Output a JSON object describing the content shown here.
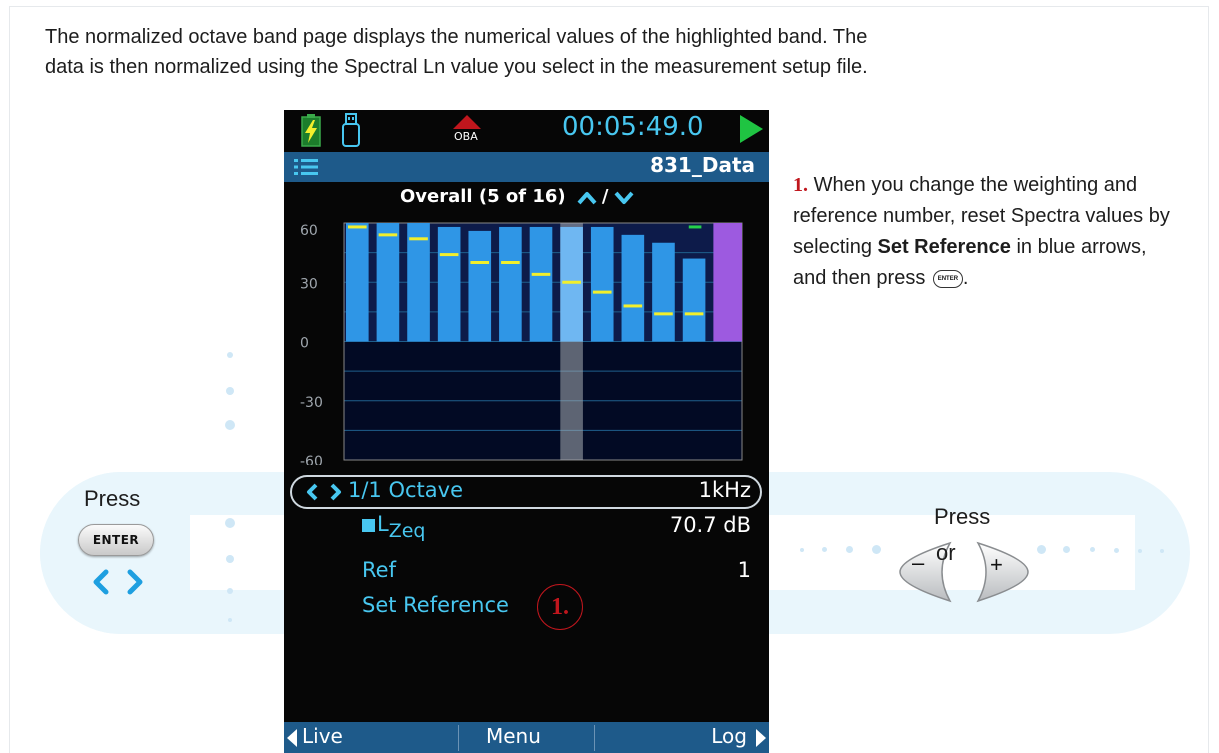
{
  "intro": {
    "line1": "The normalized octave band page displays the numerical values of the highlighted band. The",
    "line2": "data is then normalized using the Spectral Ln value you select in the measurement setup file."
  },
  "left_panel": {
    "press_label": "Press",
    "enter_label": "ENTER"
  },
  "right_panel": {
    "press_label": "Press",
    "or_label": "or",
    "minus_label": "–",
    "plus_label": "+"
  },
  "device": {
    "status": {
      "mode_label": "OBA",
      "clock": "00:05:49.0"
    },
    "title": "831_Data",
    "overall_label": "Overall (5 of 16)",
    "overall_sep": "/",
    "chart": {
      "y_ticks": [
        "60",
        "30",
        "0",
        "-30",
        "-60"
      ],
      "ylim": [
        -60,
        60
      ],
      "bars": [
        60,
        60,
        60,
        58,
        56,
        58,
        58,
        58,
        58,
        54,
        50,
        42
      ],
      "overall_bar": 60,
      "yellow_marks": [
        58,
        54,
        52,
        44,
        40,
        40,
        34,
        30,
        25,
        18,
        14,
        14
      ],
      "green_mark": 58,
      "highlight_index": 7
    },
    "rows": {
      "octave_label": "1/1 Octave",
      "octave_value": "1kHz",
      "lzeq_label": "L",
      "lzeq_sub": "Zeq",
      "lzeq_value": "70.7 dB",
      "ref_label": "Ref",
      "ref_value": "1",
      "set_reference": "Set Reference"
    },
    "softkeys": {
      "left": "Live",
      "center": "Menu",
      "right": "Log"
    },
    "colors": {
      "accent": "#48c7f0",
      "bar": "#2f96e6",
      "highlight": "#6fb7f2",
      "overall": "#9d5ae0",
      "yellow": "#f2ef2c",
      "green": "#25d14a"
    }
  },
  "callout": {
    "number": "1.",
    "text_a": "When you change the weighting and reference number, reset Spectra values by selecting",
    "bold": "Set Reference",
    "text_b": "in blue arrows, and then press",
    "enter_mini": "ENTER",
    "end": "."
  },
  "marker": "1."
}
